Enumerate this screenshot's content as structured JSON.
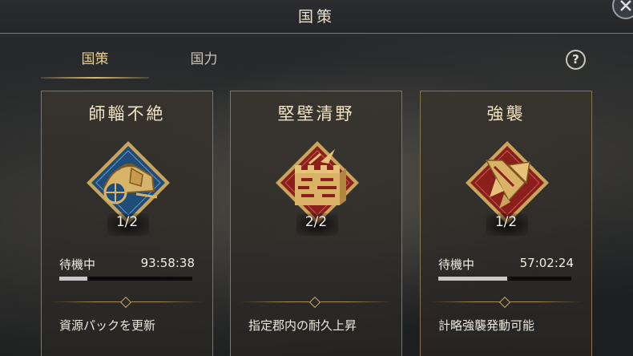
{
  "header": {
    "title": "国策"
  },
  "tabs": [
    {
      "label": "国策",
      "active": true
    },
    {
      "label": "国力",
      "active": false
    }
  ],
  "help": {
    "label": "?"
  },
  "cards": [
    {
      "title": "師輜不絶",
      "count": "1/2",
      "status": "待機中",
      "timer": "93:58:38",
      "progress": 0.21,
      "description": "資源パックを更新",
      "emblem": "supply-wagon-icon"
    },
    {
      "title": "堅壁清野",
      "count": "2/2",
      "status": "",
      "timer": "",
      "progress": null,
      "description": "指定郡内の耐久上昇",
      "emblem": "fortress-wall-icon"
    },
    {
      "title": "強襲",
      "count": "1/2",
      "status": "待機中",
      "timer": "57:02:24",
      "progress": 0.52,
      "description": "計略強襲発動可能",
      "emblem": "blade-banner-icon"
    }
  ],
  "colors": {
    "accent_gold": "#d8bb7a",
    "frame_gold": "#8a7548",
    "emblem_blue": "#1e4d7a",
    "emblem_red": "#8a1f1c",
    "progress_fill": "#c9c9c9"
  }
}
